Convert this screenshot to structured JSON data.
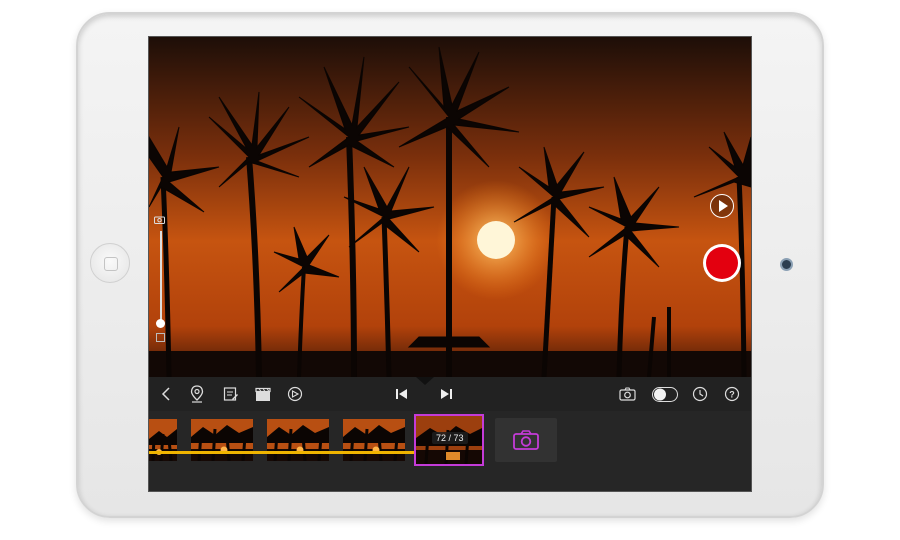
{
  "device": {
    "color": "white",
    "type": "tablet"
  },
  "viewer": {
    "icons": {
      "zoom_camera": "camera-icon",
      "play": "play-icon",
      "record": "record-button"
    },
    "zoom_level": 0.0
  },
  "toolbar": {
    "left_icons": [
      "back-chevron-icon",
      "location-pin-icon",
      "edit-note-icon",
      "clapperboard-icon",
      "speed-dial-icon"
    ],
    "center_icons": [
      "skip-back-icon",
      "skip-forward-icon"
    ],
    "right_icons": [
      "camera-icon",
      "toggle-switch",
      "clock-icon",
      "help-icon"
    ],
    "help_label": "?",
    "toggle_on": false
  },
  "timeline": {
    "frame_counter": "72 / 73",
    "progress": 0.986,
    "accent_color": "#c43bd8",
    "playhead_color": "#f0b400"
  },
  "colors": {
    "record": "#e3000f",
    "sky": "#c24a0a"
  }
}
